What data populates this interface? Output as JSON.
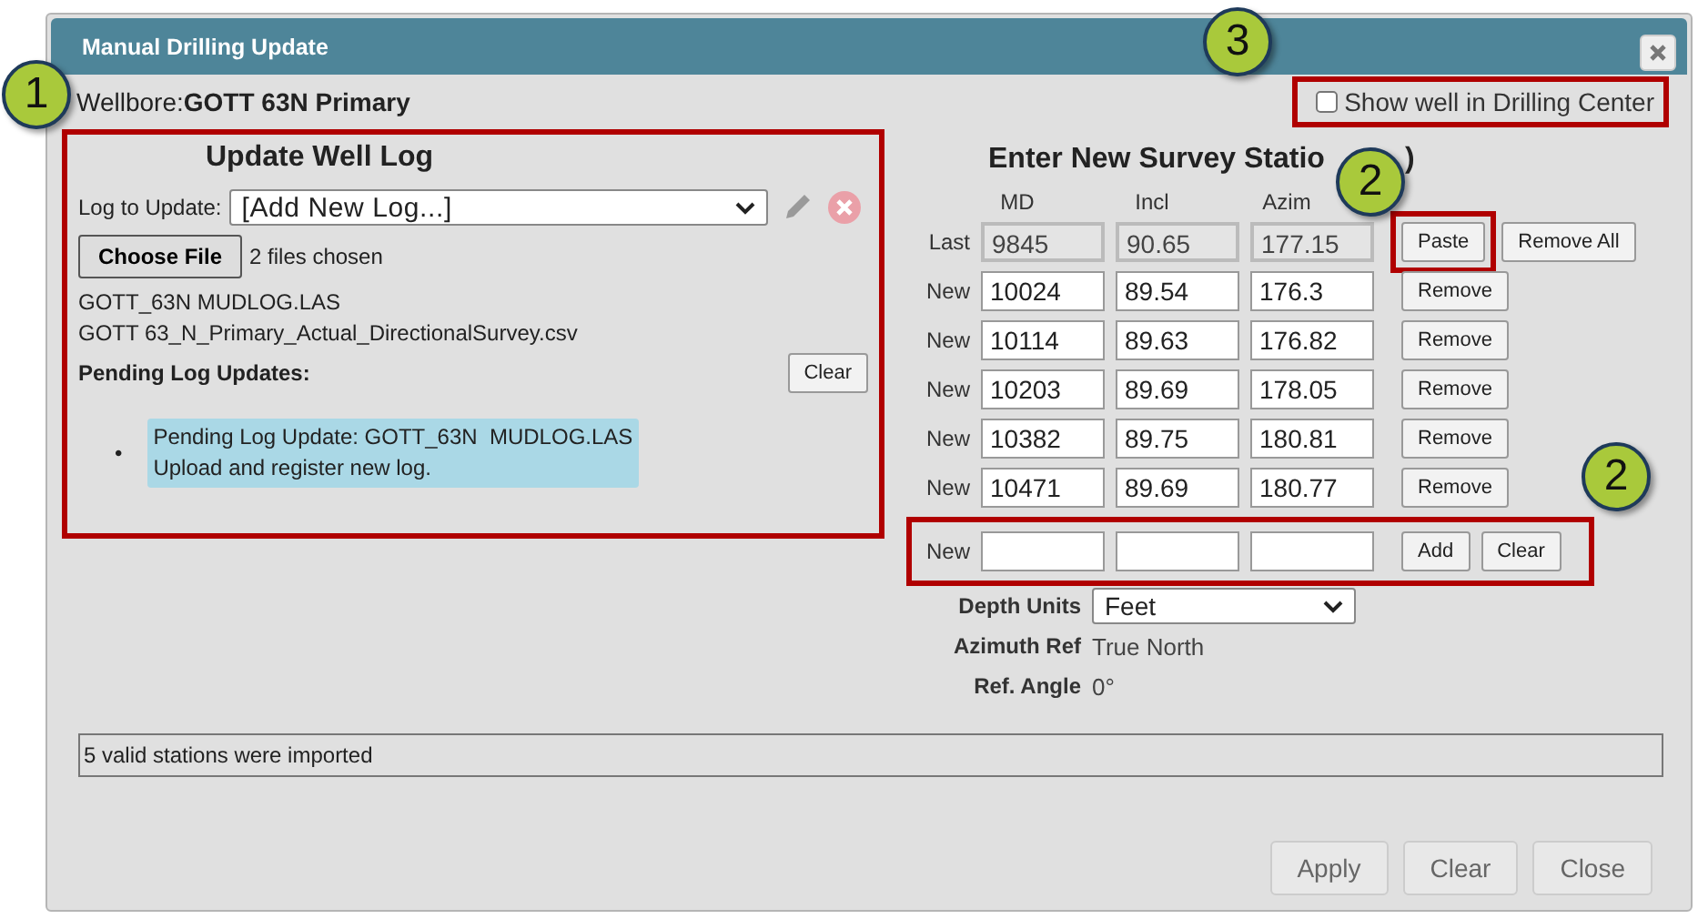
{
  "window": {
    "title": "Manual Drilling Update"
  },
  "wellbore": {
    "label": "Wellbore:",
    "name": "GOTT 63N Primary"
  },
  "show_in_center": {
    "label": "Show well in Drilling Center",
    "checked": false,
    "highlighted": true
  },
  "log_panel": {
    "title": "Update Well Log",
    "highlighted": true,
    "log_label": "Log to Update:",
    "log_value": "[Add New Log...]",
    "file_button": "Choose File",
    "file_status": "2 files chosen",
    "files": [
      "GOTT_63N MUDLOG.LAS",
      "GOTT 63_N_Primary_Actual_DirectionalSurvey.csv"
    ],
    "pending_title": "Pending Log Updates:",
    "clear_button": "Clear",
    "pending": [
      {
        "marker": "•",
        "text": "Pending Log Update: GOTT_63N  MUDLOG.LAS\nUpload and register new log."
      }
    ]
  },
  "survey": {
    "title": "Enter New Survey Statio",
    "title_tail": ")",
    "columns": [
      "MD",
      "Incl",
      "Azim"
    ],
    "rows": [
      {
        "label": "Last",
        "readonly": true,
        "values": [
          "9845",
          "90.65",
          "177.15"
        ],
        "actions": [
          {
            "label": "Paste",
            "highlighted": true
          },
          {
            "label": "Remove All",
            "highlighted": false
          }
        ]
      },
      {
        "label": "New",
        "readonly": false,
        "values": [
          "10024",
          "89.54",
          "176.3"
        ],
        "actions": [
          {
            "label": "Remove",
            "highlighted": false
          }
        ]
      },
      {
        "label": "New",
        "readonly": false,
        "values": [
          "10114",
          "89.63",
          "176.82"
        ],
        "actions": [
          {
            "label": "Remove",
            "highlighted": false
          }
        ]
      },
      {
        "label": "New",
        "readonly": false,
        "values": [
          "10203",
          "89.69",
          "178.05"
        ],
        "actions": [
          {
            "label": "Remove",
            "highlighted": false
          }
        ]
      },
      {
        "label": "New",
        "readonly": false,
        "values": [
          "10382",
          "89.75",
          "180.81"
        ],
        "actions": [
          {
            "label": "Remove",
            "highlighted": false
          }
        ]
      },
      {
        "label": "New",
        "readonly": false,
        "values": [
          "10471",
          "89.69",
          "180.77"
        ],
        "actions": [
          {
            "label": "Remove",
            "highlighted": false
          }
        ]
      }
    ],
    "entry": {
      "label": "New",
      "highlighted": true,
      "actions": [
        "Add",
        "Clear"
      ]
    },
    "settings": [
      {
        "kind": "select",
        "label": "Depth Units",
        "value": "Feet"
      },
      {
        "kind": "text",
        "label": "Azimuth Ref",
        "value": "True North"
      },
      {
        "kind": "text",
        "label": "Ref. Angle",
        "value": "0°"
      }
    ]
  },
  "status_bar": "5 valid stations were imported",
  "buttons": [
    "Apply",
    "Clear",
    "Close"
  ],
  "callouts": [
    "1",
    "3",
    "2",
    "2"
  ]
}
